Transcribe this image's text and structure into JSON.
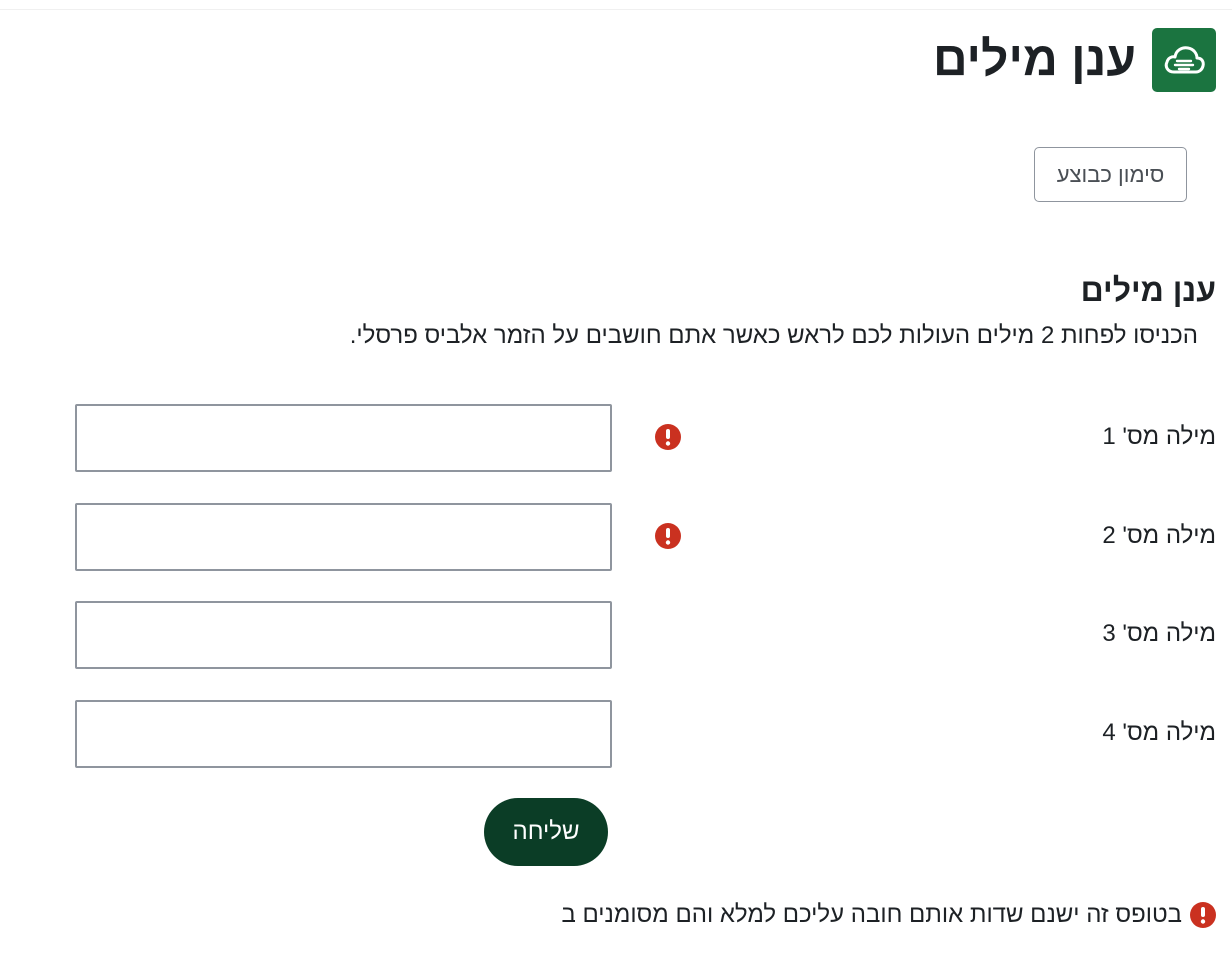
{
  "header": {
    "title": "ענן מילים",
    "icon": "word-cloud-icon",
    "icon_bg": "#1b7440"
  },
  "actions": {
    "mark_done_label": "סימון כבוצע"
  },
  "section": {
    "title": "ענן מילים",
    "instructions": "הכניסו לפחות 2 מילים העולות לכם לראש כאשר אתם חושבים על הזמר אלביס פרסלי."
  },
  "fields": [
    {
      "label": "מילה מס' 1",
      "value": "",
      "required": true
    },
    {
      "label": "מילה מס' 2",
      "value": "",
      "required": true
    },
    {
      "label": "מילה מס' 3",
      "value": "",
      "required": false
    },
    {
      "label": "מילה מס' 4",
      "value": "",
      "required": false
    }
  ],
  "submit_label": "שליחה",
  "footer": {
    "required_note": "בטופס זה ישנם שדות אותם חובה עליכם למלא והם מסומנים ב"
  },
  "colors": {
    "primary_dark": "#0b3d26",
    "required": "#ca3120",
    "border": "#8f959e"
  }
}
